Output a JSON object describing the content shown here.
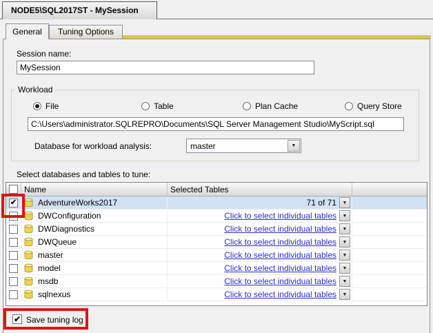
{
  "window": {
    "document_tab": "NODE5\\SQL2017ST - MySession"
  },
  "tabs": [
    {
      "label": "General",
      "active": true
    },
    {
      "label": "Tuning Options",
      "active": false
    }
  ],
  "general": {
    "session_name_label": "Session name:",
    "session_name_value": "MySession",
    "workload": {
      "group_label": "Workload",
      "options": [
        {
          "label": "File",
          "selected": true
        },
        {
          "label": "Table",
          "selected": false
        },
        {
          "label": "Plan Cache",
          "selected": false
        },
        {
          "label": "Query Store",
          "selected": false
        }
      ],
      "file_path": "C:\\Users\\administrator.SQLREPRO\\Documents\\SQL Server Management Studio\\MyScript.sql",
      "database_label": "Database for workload analysis:",
      "database_value": "master"
    },
    "tables_label": "Select databases and tables to tune:",
    "grid": {
      "columns": [
        "Name",
        "Selected Tables"
      ],
      "rows": [
        {
          "name": "AdventureWorks2017",
          "checked": true,
          "selected": true,
          "link": false,
          "selected_tables": "71 of 71"
        },
        {
          "name": "DWConfiguration",
          "checked": false,
          "selected": false,
          "link": true,
          "selected_tables": "Click to select individual tables"
        },
        {
          "name": "DWDiagnostics",
          "checked": false,
          "selected": false,
          "link": true,
          "selected_tables": "Click to select individual tables"
        },
        {
          "name": "DWQueue",
          "checked": false,
          "selected": false,
          "link": true,
          "selected_tables": "Click to select individual tables"
        },
        {
          "name": "master",
          "checked": false,
          "selected": false,
          "link": true,
          "selected_tables": "Click to select individual tables"
        },
        {
          "name": "model",
          "checked": false,
          "selected": false,
          "link": true,
          "selected_tables": "Click to select individual tables"
        },
        {
          "name": "msdb",
          "checked": false,
          "selected": false,
          "link": true,
          "selected_tables": "Click to select individual tables"
        },
        {
          "name": "sqlnexus",
          "checked": false,
          "selected": false,
          "link": true,
          "selected_tables": "Click to select individual tables"
        }
      ]
    },
    "save_tuning_log_label": "Save tuning log",
    "save_tuning_log_checked": true
  },
  "colors": {
    "highlight_red": "#dd1412",
    "link_blue": "#2b2bd0",
    "accent_yellow": "#d9ca41",
    "selected_row_blue": "#d2e2f4",
    "database_icon_yellow": "#edd44e"
  }
}
